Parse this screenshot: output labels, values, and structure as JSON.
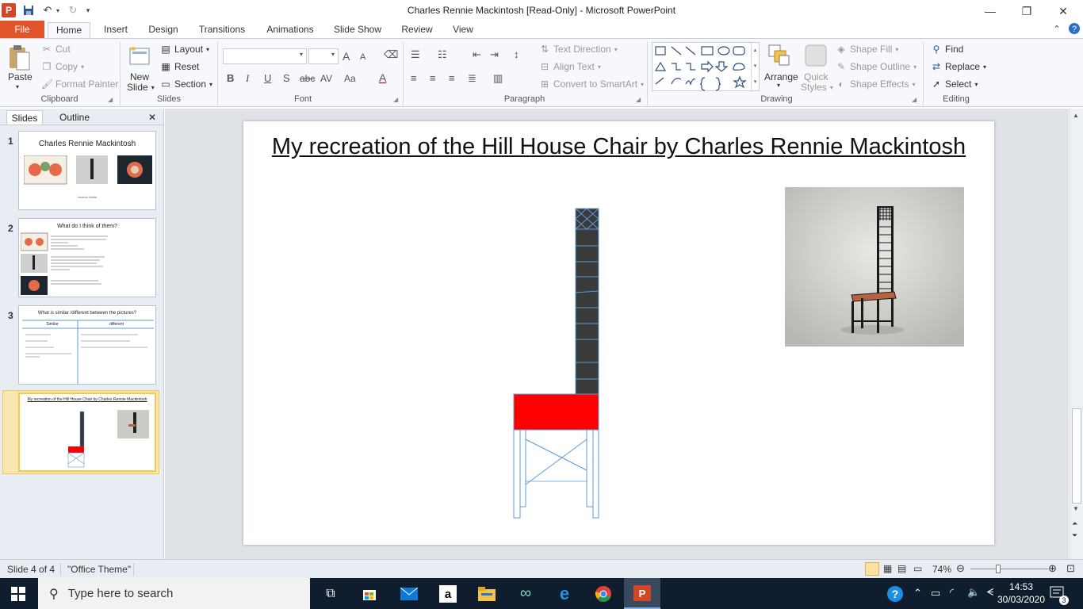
{
  "window": {
    "title": "Charles Rennie Mackintosh [Read-Only]  -  Microsoft PowerPoint",
    "controls": {
      "minimize": "—",
      "restore": "❐",
      "close": "✕"
    }
  },
  "qat": {
    "app_icon": "P",
    "save_icon": "save-icon",
    "undo_icon": "undo-icon",
    "redo_icon": "redo-icon"
  },
  "tabs": [
    "File",
    "Home",
    "Insert",
    "Design",
    "Transitions",
    "Animations",
    "Slide Show",
    "Review",
    "View"
  ],
  "ribbon": {
    "clipboard": {
      "label": "Clipboard",
      "paste": "Paste",
      "cut": "Cut",
      "copy": "Copy",
      "format_painter": "Format Painter"
    },
    "slides": {
      "label": "Slides",
      "new_slide_1": "New",
      "new_slide_2": "Slide",
      "layout": "Layout",
      "reset": "Reset",
      "section": "Section"
    },
    "font": {
      "label": "Font",
      "bold": "B",
      "italic": "I",
      "underline": "U",
      "shadow": "S",
      "strike": "abc",
      "spacing": "AV",
      "case": "Aa",
      "color": "A",
      "grow": "A",
      "shrink": "A"
    },
    "paragraph": {
      "label": "Paragraph",
      "text_direction": "Text Direction",
      "align_text": "Align Text",
      "convert_smartart": "Convert to SmartArt"
    },
    "drawing": {
      "label": "Drawing",
      "arrange": "Arrange",
      "quick_styles_1": "Quick",
      "quick_styles_2": "Styles",
      "shape_fill": "Shape Fill",
      "shape_outline": "Shape Outline",
      "shape_effects": "Shape Effects"
    },
    "editing": {
      "label": "Editing",
      "find": "Find",
      "replace": "Replace",
      "select": "Select"
    }
  },
  "left_pane": {
    "tabs": [
      "Slides",
      "Outline"
    ],
    "close": "✕",
    "thumbs": [
      {
        "num": "1",
        "title": "Charles Rennie Mackintosh",
        "caption": "Jessica Hutter"
      },
      {
        "num": "2",
        "title": "What do I think of them?"
      },
      {
        "num": "3",
        "title": "What is similar /different  between  the pictures?",
        "col1": "Similar",
        "col2": "different"
      },
      {
        "num": "4",
        "title": "My recreation of the Hill House Chair by Charles Rennie Mackintosh"
      }
    ]
  },
  "slide": {
    "title": "My recreation of the Hill House Chair by Charles Rennie Mackintosh"
  },
  "status": {
    "slide_info": "Slide 4 of 4",
    "theme": "\"Office Theme\"",
    "zoom": "74%",
    "zoom_level": 0.74
  },
  "taskbar": {
    "search_placeholder": "Type here to search",
    "time": "14:53",
    "date": "30/03/2020",
    "notifications": "3"
  },
  "colors": {
    "file_tab": "#e2542b",
    "chair_seat": "#ff0000",
    "chair_back": "#3a3a3a",
    "chair_lines": "#5b9bd5",
    "taskbar": "#101d2e"
  }
}
